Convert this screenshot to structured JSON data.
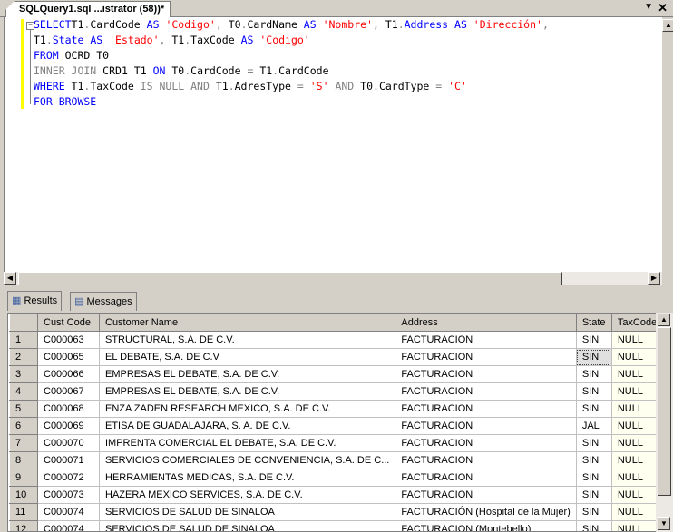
{
  "editor_tab": {
    "title": "SQLQuery1.sql ...istrator (58))*"
  },
  "query": {
    "lines": [
      [
        [
          "kw",
          "SELECT"
        ],
        [
          "",
          "T1"
        ],
        [
          "gr",
          "."
        ],
        [
          "",
          "CardCode "
        ],
        [
          "kw",
          "AS "
        ],
        [
          "str",
          "'Codigo'"
        ],
        [
          "gr",
          ", "
        ],
        [
          "",
          "T0"
        ],
        [
          "gr",
          "."
        ],
        [
          "",
          "CardName "
        ],
        [
          "kw",
          "AS "
        ],
        [
          "str",
          "'Nombre'"
        ],
        [
          "gr",
          ", "
        ],
        [
          "",
          "T1"
        ],
        [
          "gr",
          "."
        ],
        [
          "kw",
          "Address "
        ],
        [
          "kw",
          "AS "
        ],
        [
          "str",
          "'Dirección'"
        ],
        [
          "gr",
          ","
        ]
      ],
      [
        [
          "",
          "T1"
        ],
        [
          "gr",
          "."
        ],
        [
          "kw",
          "State "
        ],
        [
          "kw",
          "AS "
        ],
        [
          "str",
          "'Estado'"
        ],
        [
          "gr",
          ", "
        ],
        [
          "",
          "T1"
        ],
        [
          "gr",
          "."
        ],
        [
          "",
          "TaxCode "
        ],
        [
          "kw",
          "AS "
        ],
        [
          "str",
          "'Codigo'"
        ]
      ],
      [
        [
          "kw",
          "FROM "
        ],
        [
          "",
          "OCRD T0"
        ]
      ],
      [
        [
          "gr",
          "INNER JOIN "
        ],
        [
          "",
          "CRD1 T1 "
        ],
        [
          "kw",
          "ON "
        ],
        [
          "",
          "T0"
        ],
        [
          "gr",
          "."
        ],
        [
          "",
          "CardCode "
        ],
        [
          "gr",
          "= "
        ],
        [
          "",
          "T1"
        ],
        [
          "gr",
          "."
        ],
        [
          "",
          "CardCode"
        ]
      ],
      [
        [
          "kw",
          "WHERE "
        ],
        [
          "",
          "T1"
        ],
        [
          "gr",
          "."
        ],
        [
          "",
          "TaxCode "
        ],
        [
          "gr",
          "IS NULL AND "
        ],
        [
          "",
          "T1"
        ],
        [
          "gr",
          "."
        ],
        [
          "",
          "AdresType "
        ],
        [
          "gr",
          "= "
        ],
        [
          "str",
          "'S'"
        ],
        [
          "gr",
          " AND "
        ],
        [
          "",
          "T0"
        ],
        [
          "gr",
          "."
        ],
        [
          "",
          "CardType "
        ],
        [
          "gr",
          "= "
        ],
        [
          "str",
          "'C'"
        ]
      ],
      [
        [
          "kw",
          "FOR BROWSE"
        ]
      ]
    ]
  },
  "results_tabs": [
    {
      "label": "Results"
    },
    {
      "label": "Messages"
    }
  ],
  "grid": {
    "columns": [
      "",
      "Cust Code",
      "Customer Name",
      "Address",
      "State",
      "TaxCode"
    ],
    "rows": [
      [
        "1",
        "C000063",
        "STRUCTURAL, S.A. DE C.V.",
        "FACTURACION",
        "SIN",
        "NULL"
      ],
      [
        "2",
        "C000065",
        "EL DEBATE, S.A. DE C.V",
        "FACTURACION",
        "SIN",
        "NULL"
      ],
      [
        "3",
        "C000066",
        "EMPRESAS EL DEBATE, S.A. DE C.V.",
        "FACTURACION",
        "SIN",
        "NULL"
      ],
      [
        "4",
        "C000067",
        "EMPRESAS EL DEBATE, S.A. DE C.V.",
        "FACTURACION",
        "SIN",
        "NULL"
      ],
      [
        "5",
        "C000068",
        "ENZA ZADEN RESEARCH MEXICO, S.A. DE C.V.",
        "FACTURACION",
        "SIN",
        "NULL"
      ],
      [
        "6",
        "C000069",
        "ETISA DE GUADALAJARA, S. A. DE C.V.",
        "FACTURACION",
        "JAL",
        "NULL"
      ],
      [
        "7",
        "C000070",
        "IMPRENTA COMERCIAL EL DEBATE, S.A. DE C.V.",
        "FACTURACION",
        "SIN",
        "NULL"
      ],
      [
        "8",
        "C000071",
        "SERVICIOS COMERCIALES DE CONVENIENCIA, S.A. DE C...",
        "FACTURACION",
        "SIN",
        "NULL"
      ],
      [
        "9",
        "C000072",
        "HERRAMIENTAS MEDICAS, S.A. DE C.V.",
        "FACTURACION",
        "SIN",
        "NULL"
      ],
      [
        "10",
        "C000073",
        "HAZERA MEXICO SERVICES, S.A. DE C.V.",
        "FACTURACION",
        "SIN",
        "NULL"
      ],
      [
        "11",
        "C000074",
        "SERVICIOS DE SALUD DE SINALOA",
        "FACTURACIÓN (Hospital de la Mujer)",
        "SIN",
        "NULL"
      ],
      [
        "12",
        "C000074",
        "SERVICIOS DE SALUD DE SINALOA",
        "FACTURACION (Montebello)",
        "SIN",
        "NULL"
      ]
    ]
  }
}
